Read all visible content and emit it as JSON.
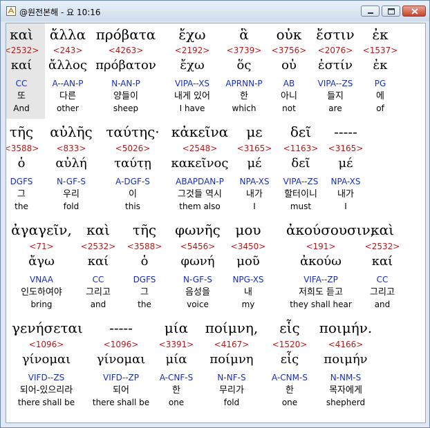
{
  "window": {
    "title": "@원전본해 - 요 10:16"
  },
  "lines": [
    {
      "words": [
        {
          "greek": "καὶ",
          "strong": "<2532>",
          "lemma": "καί",
          "parse": "CC",
          "korean": "또",
          "english": "And"
        },
        {
          "greek": "ἄλλα",
          "strong": "<243>",
          "lemma": "ἄλλος",
          "parse": "A--AN-P",
          "korean": "다른",
          "english": "other"
        },
        {
          "greek": "πρόβατα",
          "strong": "<4263>",
          "lemma": "πρόβατον",
          "parse": "N-AN-P",
          "korean": "양들이",
          "english": "sheep"
        },
        {
          "greek": "ἔχω",
          "strong": "<2192>",
          "lemma": "ἔχω",
          "parse": "VIPA--XS",
          "korean": "내게 있어",
          "english": "I have"
        },
        {
          "greek": "ἃ",
          "strong": "<3739>",
          "lemma": "ὅς",
          "parse": "APRNN-P",
          "korean": "한",
          "english": "which"
        },
        {
          "greek": "οὐκ",
          "strong": "<3756>",
          "lemma": "οὐ",
          "parse": "AB",
          "korean": "아니",
          "english": "not"
        },
        {
          "greek": "ἔστιν",
          "strong": "<2076>",
          "lemma": "ἐστίν",
          "parse": "VIPA--ZS",
          "korean": "들지",
          "english": "are"
        },
        {
          "greek": "ἐκ",
          "strong": "<1537>",
          "lemma": "ἐκ",
          "parse": "PG",
          "korean": "에",
          "english": "of"
        }
      ]
    },
    {
      "words": [
        {
          "greek": "τῆς",
          "strong": "<3588>",
          "lemma": "ὁ",
          "parse": "DGFS",
          "korean": "그",
          "english": "the"
        },
        {
          "greek": "αὐλῆς",
          "strong": "<833>",
          "lemma": "αὐλή",
          "parse": "N-GF-S",
          "korean": "우리",
          "english": "fold"
        },
        {
          "greek": "ταύτης·",
          "strong": "<5026>",
          "lemma": "ταύτῃ",
          "parse": "A-DGF-S",
          "korean": "이",
          "english": "this"
        },
        {
          "greek": "κἀκεῖνα",
          "strong": "<2548>",
          "lemma": "κακεῖνος",
          "parse": "ABAPDAN-P",
          "korean": "그것들 역시",
          "english": "them also"
        },
        {
          "greek": "με",
          "strong": "<3165>",
          "lemma": "μέ",
          "parse": "NPA-XS",
          "korean": "내가",
          "english": "I"
        },
        {
          "greek": "δεῖ",
          "strong": "<1163>",
          "lemma": "δεῖ",
          "parse": "VIPA--ZS",
          "korean": "할터이니",
          "english": "must"
        },
        {
          "greek": "-----",
          "strong": "<3165>",
          "lemma": "μέ",
          "parse": "NPA-XS",
          "korean": "내가",
          "english": "I"
        }
      ]
    },
    {
      "words": [
        {
          "greek": "ἀγαγεῖν,",
          "strong": "<71>",
          "lemma": "ἄγω",
          "parse": "VNAA",
          "korean": "인도하여야",
          "english": "bring"
        },
        {
          "greek": "καὶ",
          "strong": "<2532>",
          "lemma": "καί",
          "parse": "CC",
          "korean": "그리고",
          "english": "and"
        },
        {
          "greek": "τῆς",
          "strong": "<3588>",
          "lemma": "ὁ",
          "parse": "DGFS",
          "korean": "그",
          "english": "the"
        },
        {
          "greek": "φωνῆς",
          "strong": "<5456>",
          "lemma": "φωνή",
          "parse": "N-GF-S",
          "korean": "음성을",
          "english": "voice"
        },
        {
          "greek": "μου",
          "strong": "<3450>",
          "lemma": "μοῦ",
          "parse": "NPG-XS",
          "korean": "내",
          "english": "my"
        },
        {
          "greek": "ἀκούσουσιν,",
          "strong": "<191>",
          "lemma": "ἀκούω",
          "parse": "VIFA--ZP",
          "korean": "저희도 듣고",
          "english": "they shall hear"
        },
        {
          "greek": "καὶ",
          "strong": "<2532>",
          "lemma": "καί",
          "parse": "CC",
          "korean": "그리고",
          "english": "and"
        }
      ]
    },
    {
      "words": [
        {
          "greek": "γενήσεται",
          "strong": "<1096>",
          "lemma": "γίνομαι",
          "parse": "VIFD--ZS",
          "korean": "되어-있으리라",
          "english": "there shall be"
        },
        {
          "greek": "-----",
          "strong": "<1096>",
          "lemma": "γίνομαι",
          "parse": "VIFD--ZP",
          "korean": "되어",
          "english": "there shall be"
        },
        {
          "greek": "μία",
          "strong": "<3391>",
          "lemma": "μία",
          "parse": "A-CNF-S",
          "korean": "한",
          "english": "one"
        },
        {
          "greek": "ποίμνη,",
          "strong": "<4167>",
          "lemma": "ποίμνη",
          "parse": "N-NF-S",
          "korean": "무리가",
          "english": "fold"
        },
        {
          "greek": "εἷς",
          "strong": "<1520>",
          "lemma": "εἷς",
          "parse": "A-CNM-S",
          "korean": "한",
          "english": "one"
        },
        {
          "greek": "ποιμήν.",
          "strong": "<4166>",
          "lemma": "ποιμήν",
          "parse": "N-NM-S",
          "korean": "목자에게",
          "english": "shepherd"
        }
      ]
    }
  ]
}
